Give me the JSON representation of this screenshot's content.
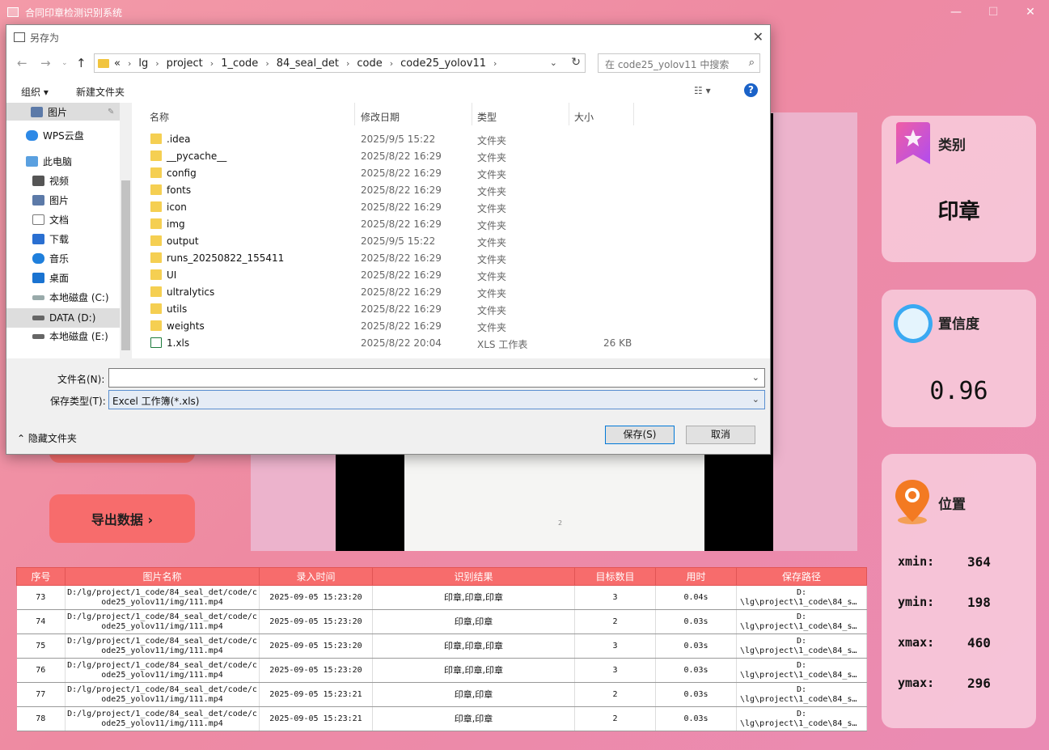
{
  "app": {
    "title": "合同印章检测识别系统",
    "minimize": "—",
    "maximize": "☐",
    "close": "✕"
  },
  "cards": {
    "category": {
      "title": "类别",
      "value": "印章"
    },
    "confidence": {
      "title": "置信度",
      "value": "0.96"
    },
    "position": {
      "title": "位置",
      "rows": [
        {
          "label": "xmin:",
          "value": "364"
        },
        {
          "label": "ymin:",
          "value": "198"
        },
        {
          "label": "xmax:",
          "value": "460"
        },
        {
          "label": "ymax:",
          "value": "296"
        }
      ]
    }
  },
  "left_buttons": {
    "export": "导出数据 ›"
  },
  "video": {
    "page_mark": "2"
  },
  "table": {
    "headers": [
      "序号",
      "图片名称",
      "录入时间",
      "识别结果",
      "目标数目",
      "用时",
      "保存路径"
    ],
    "rows": [
      {
        "id": "73",
        "name": "D:/lg/project/1_code/84_seal_det/code/code25_yolov11/img/111.mp4",
        "time": "2025-09-05 15:23:20",
        "result": "印章,印章,印章",
        "count": "3",
        "dur": "0.04s",
        "path1": "D:",
        "path2": "\\lg\\project\\1_code\\84_s…"
      },
      {
        "id": "74",
        "name": "D:/lg/project/1_code/84_seal_det/code/code25_yolov11/img/111.mp4",
        "time": "2025-09-05 15:23:20",
        "result": "印章,印章",
        "count": "2",
        "dur": "0.03s",
        "path1": "D:",
        "path2": "\\lg\\project\\1_code\\84_s…"
      },
      {
        "id": "75",
        "name": "D:/lg/project/1_code/84_seal_det/code/code25_yolov11/img/111.mp4",
        "time": "2025-09-05 15:23:20",
        "result": "印章,印章,印章",
        "count": "3",
        "dur": "0.03s",
        "path1": "D:",
        "path2": "\\lg\\project\\1_code\\84_s…"
      },
      {
        "id": "76",
        "name": "D:/lg/project/1_code/84_seal_det/code/code25_yolov11/img/111.mp4",
        "time": "2025-09-05 15:23:20",
        "result": "印章,印章,印章",
        "count": "3",
        "dur": "0.03s",
        "path1": "D:",
        "path2": "\\lg\\project\\1_code\\84_s…"
      },
      {
        "id": "77",
        "name": "D:/lg/project/1_code/84_seal_det/code/code25_yolov11/img/111.mp4",
        "time": "2025-09-05 15:23:21",
        "result": "印章,印章",
        "count": "2",
        "dur": "0.03s",
        "path1": "D:",
        "path2": "\\lg\\project\\1_code\\84_s…"
      },
      {
        "id": "78",
        "name": "D:/lg/project/1_code/84_seal_det/code/code25_yolov11/img/111.mp4",
        "time": "2025-09-05 15:23:21",
        "result": "印章,印章",
        "count": "2",
        "dur": "0.03s",
        "path1": "D:",
        "path2": "\\lg\\project\\1_code\\84_s…"
      }
    ]
  },
  "dialog": {
    "title": "另存为",
    "close": "✕",
    "breadcrumb": [
      "«",
      "lg",
      "project",
      "1_code",
      "84_seal_det",
      "code",
      "code25_yolov11"
    ],
    "search_placeholder": "在 code25_yolov11 中搜索",
    "toolbar": {
      "organize": "组织 ▾",
      "new_folder": "新建文件夹",
      "help": "?"
    },
    "nav_items": [
      {
        "label": "图片",
        "icon": "picture-icon"
      },
      {
        "label": "WPS云盘",
        "icon": "cloud-icon"
      },
      {
        "label": "此电脑",
        "icon": "computer-icon"
      },
      {
        "label": "视频",
        "icon": "video-icon"
      },
      {
        "label": "图片",
        "icon": "picture-icon"
      },
      {
        "label": "文档",
        "icon": "document-icon"
      },
      {
        "label": "下载",
        "icon": "download-icon"
      },
      {
        "label": "音乐",
        "icon": "music-icon"
      },
      {
        "label": "桌面",
        "icon": "desktop-icon"
      },
      {
        "label": "本地磁盘 (C:)",
        "icon": "drive-icon"
      },
      {
        "label": "DATA (D:)",
        "icon": "drive-icon"
      },
      {
        "label": "本地磁盘 (E:)",
        "icon": "drive-icon"
      }
    ],
    "columns": {
      "name": "名称",
      "date": "修改日期",
      "type": "类型",
      "size": "大小"
    },
    "files": [
      {
        "name": ".idea",
        "date": "2025/9/5 15:22",
        "type": "文件夹",
        "size": ""
      },
      {
        "name": "__pycache__",
        "date": "2025/8/22 16:29",
        "type": "文件夹",
        "size": ""
      },
      {
        "name": "config",
        "date": "2025/8/22 16:29",
        "type": "文件夹",
        "size": ""
      },
      {
        "name": "fonts",
        "date": "2025/8/22 16:29",
        "type": "文件夹",
        "size": ""
      },
      {
        "name": "icon",
        "date": "2025/8/22 16:29",
        "type": "文件夹",
        "size": ""
      },
      {
        "name": "img",
        "date": "2025/8/22 16:29",
        "type": "文件夹",
        "size": ""
      },
      {
        "name": "output",
        "date": "2025/9/5 15:22",
        "type": "文件夹",
        "size": ""
      },
      {
        "name": "runs_20250822_155411",
        "date": "2025/8/22 16:29",
        "type": "文件夹",
        "size": ""
      },
      {
        "name": "UI",
        "date": "2025/8/22 16:29",
        "type": "文件夹",
        "size": ""
      },
      {
        "name": "ultralytics",
        "date": "2025/8/22 16:29",
        "type": "文件夹",
        "size": ""
      },
      {
        "name": "utils",
        "date": "2025/8/22 16:29",
        "type": "文件夹",
        "size": ""
      },
      {
        "name": "weights",
        "date": "2025/8/22 16:29",
        "type": "文件夹",
        "size": ""
      },
      {
        "name": "1.xls",
        "date": "2025/8/22 20:04",
        "type": "XLS 工作表",
        "size": "26 KB"
      }
    ],
    "filename_label": "文件名(N):",
    "filename_value": "",
    "filetype_label": "保存类型(T):",
    "filetype_value": "Excel 工作簿(*.xls)",
    "hide_folders": "隐藏文件夹",
    "save": "保存(S)",
    "cancel": "取消"
  },
  "colors": {
    "accent": "#f76c6c",
    "card": "#fad6e4",
    "link_blue": "#1a62c8"
  }
}
